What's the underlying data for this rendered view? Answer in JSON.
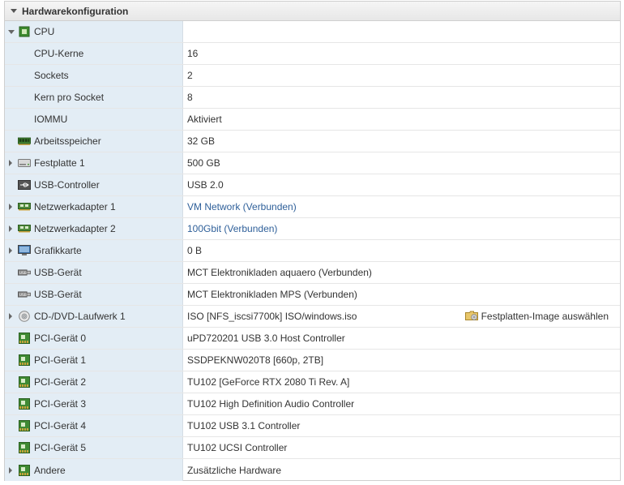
{
  "panel": {
    "title": "Hardwarekonfiguration"
  },
  "rows": [
    {
      "label": "CPU",
      "value": "",
      "icon": "cpu-icon",
      "expander": "open"
    },
    {
      "label": "CPU-Kerne",
      "value": "16",
      "icon": "",
      "expander": "none"
    },
    {
      "label": "Sockets",
      "value": "2",
      "icon": "",
      "expander": "none"
    },
    {
      "label": "Kern pro Socket",
      "value": "8",
      "icon": "",
      "expander": "none"
    },
    {
      "label": "IOMMU",
      "value": "Aktiviert",
      "icon": "",
      "expander": "none"
    },
    {
      "label": "Arbeitsspeicher",
      "value": "32 GB",
      "icon": "memory-icon",
      "expander": "none"
    },
    {
      "label": "Festplatte 1",
      "value": "500 GB",
      "icon": "harddisk-icon",
      "expander": "closed"
    },
    {
      "label": "USB-Controller",
      "value": "USB 2.0",
      "icon": "usb-controller-icon",
      "expander": "none"
    },
    {
      "label": "Netzwerkadapter 1",
      "value": "VM Network (Verbunden)",
      "icon": "network-adapter-icon",
      "expander": "closed",
      "link": true
    },
    {
      "label": "Netzwerkadapter 2",
      "value": "100Gbit (Verbunden)",
      "icon": "network-adapter-icon",
      "expander": "closed",
      "link": true
    },
    {
      "label": "Grafikkarte",
      "value": "0 B",
      "icon": "monitor-icon",
      "expander": "closed"
    },
    {
      "label": "USB-Gerät",
      "value": "MCT Elektronikladen aquaero (Verbunden)",
      "icon": "usb-device-icon",
      "expander": "none"
    },
    {
      "label": "USB-Gerät",
      "value": "MCT Elektronikladen MPS (Verbunden)",
      "icon": "usb-device-icon",
      "expander": "none"
    },
    {
      "label": "CD-/DVD-Laufwerk 1",
      "value": "ISO [NFS_iscsi7700k] ISO/windows.iso",
      "icon": "cd-dvd-icon",
      "expander": "closed",
      "action": "Festplatten-Image auswählen"
    },
    {
      "label": "PCI-Gerät 0",
      "value": "uPD720201 USB 3.0 Host Controller",
      "icon": "pci-device-icon",
      "expander": "none"
    },
    {
      "label": "PCI-Gerät 1",
      "value": "SSDPEKNW020T8 [660p, 2TB]",
      "icon": "pci-device-icon",
      "expander": "none"
    },
    {
      "label": "PCI-Gerät 2",
      "value": "TU102 [GeForce RTX 2080 Ti Rev. A]",
      "icon": "pci-device-icon",
      "expander": "none"
    },
    {
      "label": "PCI-Gerät 3",
      "value": "TU102 High Definition Audio Controller",
      "icon": "pci-device-icon",
      "expander": "none"
    },
    {
      "label": "PCI-Gerät 4",
      "value": "TU102 USB 3.1 Controller",
      "icon": "pci-device-icon",
      "expander": "none"
    },
    {
      "label": "PCI-Gerät 5",
      "value": "TU102 UCSI Controller",
      "icon": "pci-device-icon",
      "expander": "none"
    },
    {
      "label": "Andere",
      "value": "Zusätzliche Hardware",
      "icon": "pci-device-icon",
      "expander": "closed"
    }
  ],
  "colors": {
    "label_bg": "#e3edf5",
    "link": "#2e5f99"
  }
}
